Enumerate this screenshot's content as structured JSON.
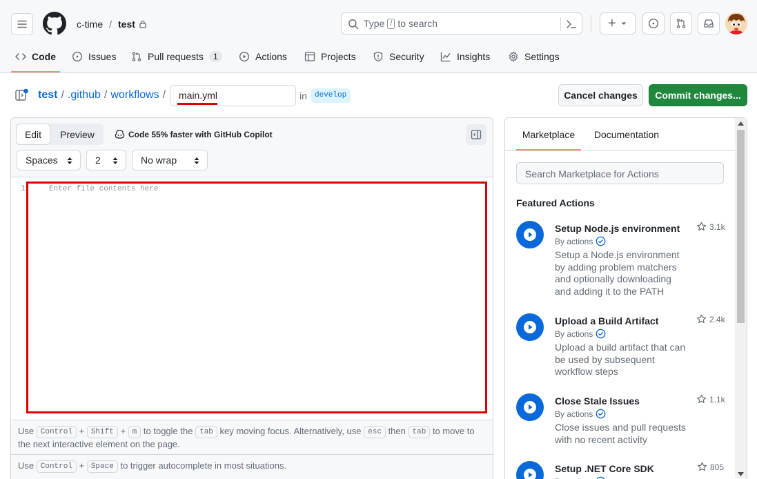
{
  "header": {
    "owner": "c-time",
    "separator": "/",
    "repo": "test",
    "search_placeholder_prefix": "Type",
    "search_key": "/",
    "search_placeholder_suffix": "to search",
    "plus_label": "+"
  },
  "repo_nav": {
    "tabs": [
      {
        "label": "Code",
        "icon": "code-icon"
      },
      {
        "label": "Issues",
        "icon": "issue-icon"
      },
      {
        "label": "Pull requests",
        "icon": "pull-request-icon",
        "count": "1"
      },
      {
        "label": "Actions",
        "icon": "play-icon"
      },
      {
        "label": "Projects",
        "icon": "table-icon"
      },
      {
        "label": "Security",
        "icon": "shield-icon"
      },
      {
        "label": "Insights",
        "icon": "graph-icon"
      },
      {
        "label": "Settings",
        "icon": "gear-icon"
      }
    ],
    "active_tab": "Code"
  },
  "breadcrumb": {
    "items": [
      "test",
      ".github",
      "workflows"
    ],
    "filename": "main.yml",
    "in_label": "in",
    "branch": "develop"
  },
  "actions_bar": {
    "cancel_label": "Cancel changes",
    "commit_label": "Commit changes..."
  },
  "editor": {
    "tab_edit": "Edit",
    "tab_preview": "Preview",
    "copilot_text": "Code 55% faster with GitHub Copilot",
    "indent_mode": "Spaces",
    "indent_size": "2",
    "wrap_mode": "No wrap",
    "line_number": "1",
    "placeholder": "Enter file contents here",
    "help_line1": {
      "t1": "Use",
      "k1": "Control",
      "p1": "+",
      "k2": "Shift",
      "p2": "+",
      "k3": "m",
      "t2": "to toggle the",
      "k4": "tab",
      "t3": "key moving focus. Alternatively, use",
      "k5": "esc",
      "t4": "then",
      "k6": "tab",
      "t5": "to move to the",
      "t6": "next interactive element on the page."
    },
    "help_line2": {
      "t1": "Use",
      "k1": "Control",
      "p1": "+",
      "k2": "Space",
      "t2": "to trigger autocomplete in most situations."
    }
  },
  "sidebar": {
    "tab_marketplace": "Marketplace",
    "tab_documentation": "Documentation",
    "search_placeholder": "Search Marketplace for Actions",
    "featured_heading": "Featured Actions",
    "actions": [
      {
        "title": "Setup Node.js environment",
        "by": "By actions",
        "stars": "3.1k",
        "description": "Setup a Node.js environment by adding problem matchers and optionally downloading and adding it to the PATH"
      },
      {
        "title": "Upload a Build Artifact",
        "by": "By actions",
        "stars": "2.4k",
        "description": "Upload a build artifact that can be used by subsequent workflow steps"
      },
      {
        "title": "Close Stale Issues",
        "by": "By actions",
        "stars": "1.1k",
        "description": "Close issues and pull requests with no recent activity"
      },
      {
        "title": "Setup .NET Core SDK",
        "by": "By actions",
        "stars": "805",
        "description": ""
      }
    ]
  },
  "colors": {
    "accent_blue": "#0969da",
    "commit_green": "#1f883d",
    "active_underline": "#fd8c73",
    "annotation_red": "#e00000"
  }
}
